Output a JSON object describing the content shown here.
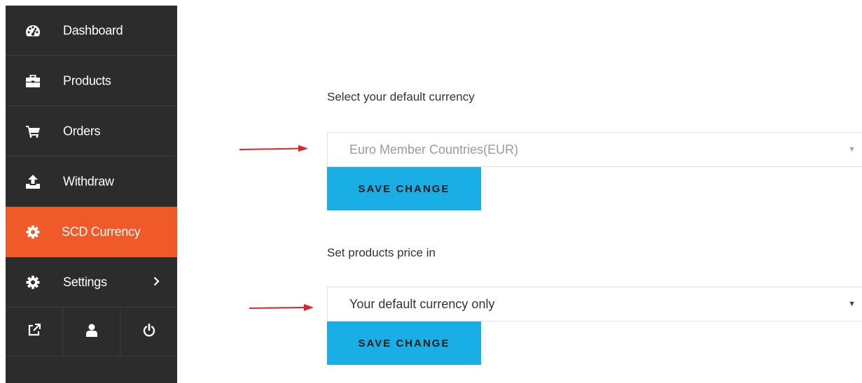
{
  "sidebar": {
    "items": [
      {
        "label": "Dashboard",
        "icon": "dashboard-icon"
      },
      {
        "label": "Products",
        "icon": "briefcase-icon"
      },
      {
        "label": "Orders",
        "icon": "cart-icon"
      },
      {
        "label": "Withdraw",
        "icon": "upload-icon"
      },
      {
        "label": "SCD Currency",
        "icon": "gear-icon",
        "active": true
      },
      {
        "label": "Settings",
        "icon": "gear-icon",
        "chevron": "›"
      }
    ],
    "bottom_icons": [
      "external-link-icon",
      "user-icon",
      "power-icon"
    ],
    "active_color": "#f05a28",
    "background_color": "#2c2c2c"
  },
  "main": {
    "default_currency": {
      "label": "Select your default currency",
      "selected": "Euro Member Countries(EUR)",
      "caret": "▼",
      "button": "SAVE CHANGE"
    },
    "price_setting": {
      "label": "Set products price in",
      "selected": "Your default currency only",
      "caret": "▼",
      "button": "SAVE CHANGE"
    },
    "button_color": "#1aaee6",
    "annotation_arrow_color": "#d8262b"
  }
}
